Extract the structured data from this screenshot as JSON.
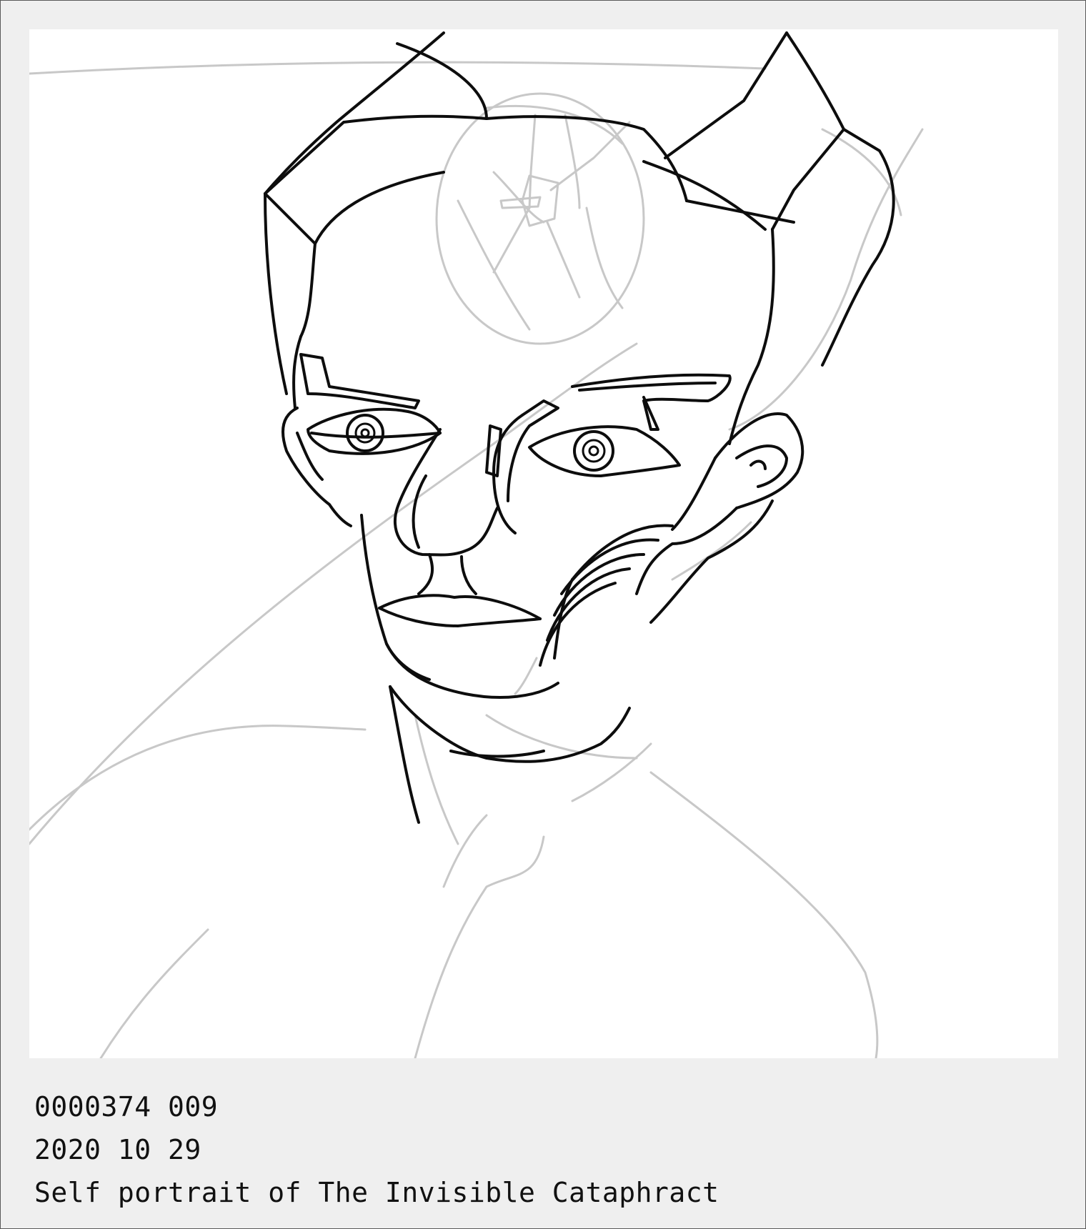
{
  "caption": {
    "line1": "0000374 009",
    "line2": "2020 10 29",
    "line3": "Self portrait of The Invisible Cataphract"
  },
  "colors": {
    "background": "#efefef",
    "canvas": "#ffffff",
    "ink": "#0d0d0d",
    "sketch": "#c8c8c8"
  }
}
